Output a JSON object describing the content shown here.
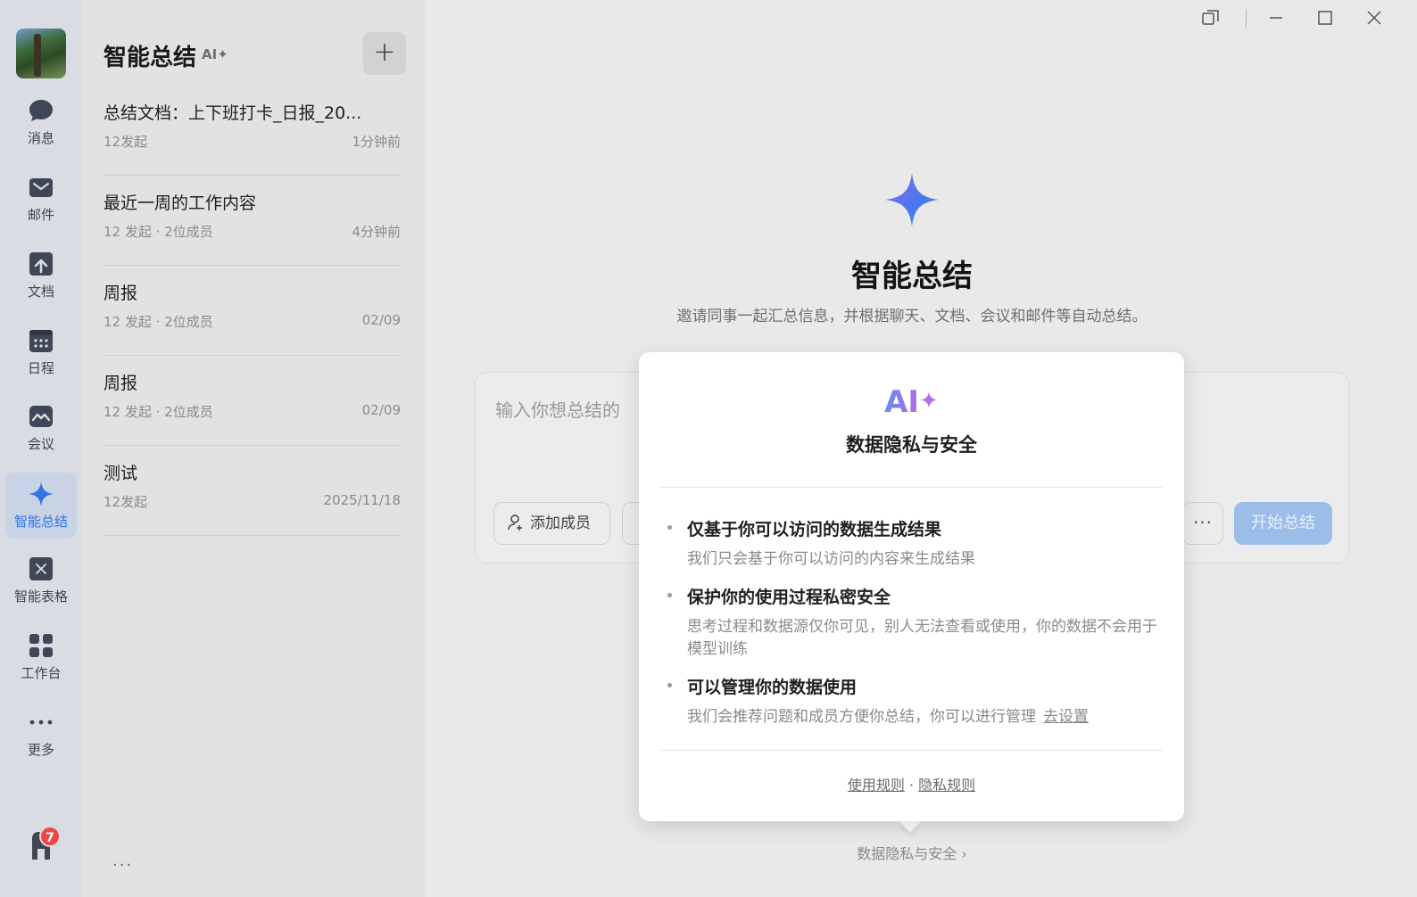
{
  "rail": {
    "items": [
      {
        "label": "消息",
        "icon": "chat-bubble-icon"
      },
      {
        "label": "邮件",
        "icon": "mail-icon"
      },
      {
        "label": "文档",
        "icon": "document-icon"
      },
      {
        "label": "日程",
        "icon": "calendar-icon"
      },
      {
        "label": "会议",
        "icon": "meeting-icon"
      },
      {
        "label": "智能总结",
        "icon": "sparkle-icon",
        "active": true
      },
      {
        "label": "智能表格",
        "icon": "smart-table-icon"
      },
      {
        "label": "工作台",
        "icon": "workbench-icon"
      },
      {
        "label": "更多",
        "icon": "more-icon"
      }
    ],
    "notification_count": "7"
  },
  "panel": {
    "title": "智能总结",
    "ai_badge": "AI✦",
    "new_button": "+",
    "items": [
      {
        "title": "总结文档：上下班打卡_日报_20...",
        "meta": "12发起",
        "time": "1分钟前"
      },
      {
        "title": "最近一周的工作内容",
        "meta": "12 发起 · 2位成员",
        "time": "4分钟前"
      },
      {
        "title": "周报",
        "meta": "12 发起 · 2位成员",
        "time": "02/09"
      },
      {
        "title": "周报",
        "meta": "12 发起 · 2位成员",
        "time": "02/09"
      },
      {
        "title": "测试",
        "meta": "12发起",
        "time": "2025/11/18"
      }
    ],
    "more": "..."
  },
  "main": {
    "title": "智能总结",
    "description": "邀请同事一起汇总信息，并根据聊天、文档、会议和邮件等自动总结。",
    "input_placeholder": "输入你想总结的",
    "add_member": "添加成员",
    "more_button": "···",
    "start_button": "开始总结",
    "privacy_link": "数据隐私与安全 ›"
  },
  "popover": {
    "ai_text": "AI",
    "ai_spark": "✦",
    "title": "数据隐私与安全",
    "points": [
      {
        "title": "仅基于你可以访问的数据生成结果",
        "desc": "我们只会基于你可以访问的内容来生成结果"
      },
      {
        "title": "保护你的使用过程私密安全",
        "desc": "思考过程和数据源仅你可见，别人无法查看或使用，你的数据不会用于模型训练"
      },
      {
        "title": "可以管理你的数据使用",
        "desc": "我们会推荐问题和成员方便你总结，你可以进行管理",
        "link": "去设置"
      }
    ],
    "footer_link1": "使用规则",
    "footer_sep": " · ",
    "footer_link2": "隐私规则"
  },
  "colors": {
    "accent": "#3274e6",
    "start_button": "#9dbde9",
    "badge": "#f04545"
  }
}
